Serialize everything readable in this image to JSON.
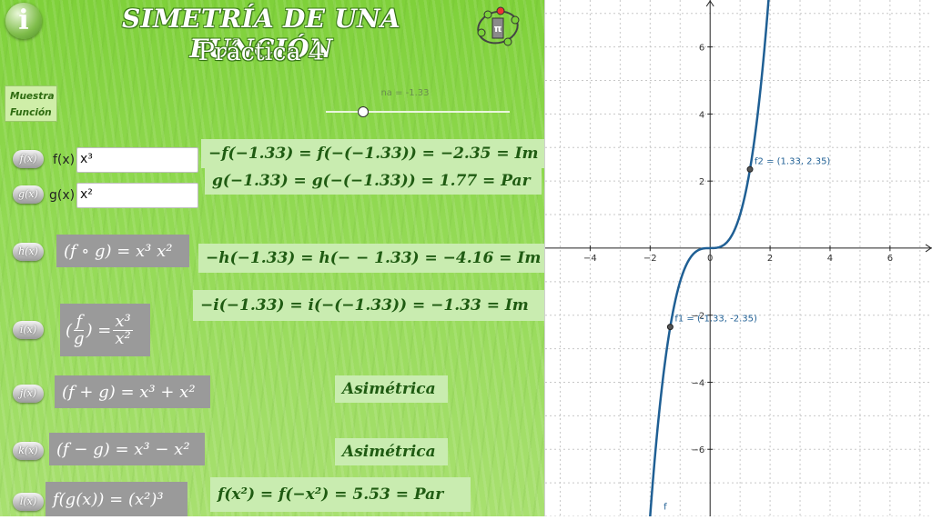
{
  "header": {
    "info_glyph": "i",
    "title": "SIMETRÍA DE UNA FUNCIÓN",
    "subtitle": "Práctica 4",
    "logo_icon": "geogebra-logo-icon"
  },
  "show_function_button": {
    "line1": "Muestra",
    "line2": "Función"
  },
  "slider": {
    "label": "na = -1.33",
    "value": -1.33,
    "min": -3,
    "max": 3
  },
  "functions": {
    "f_button": "f(x)",
    "f_label": "f(x)",
    "f_value": "x³",
    "g_button": "g(x)",
    "g_label": "g(x)",
    "g_value": "x²",
    "h_button": "h(x)",
    "i_button": "i(x)",
    "j_button": "j(x)",
    "k_button": "k(x)",
    "l_button": "l(x)"
  },
  "expressions": {
    "h": "(f ∘ g) = x³ x²",
    "i_left": "(",
    "i_num_f": "f",
    "i_den_g": "g",
    "i_mid": ") =",
    "i_num": "x³",
    "i_den": "x²",
    "j": "(f + g) = x³ + x²",
    "k": "(f − g) = x³ − x²",
    "l": "f(g(x)) = (x²)³"
  },
  "results": {
    "f": "−f(−1.33) = f(−(−1.33)) = −2.35 = Im",
    "g": "g(−1.33) = g(−(−1.33)) = 1.77 = Par",
    "h": "−h(−1.33) = h(− − 1.33) = −4.16 = Im",
    "i": "−i(−1.33) = i(−(−1.33)) = −1.33 = Im",
    "j": "Asimétrica",
    "k": "Asimétrica",
    "l": "f(x²) = f(−x²) = 5.53 = Par"
  },
  "graph": {
    "x_ticks": [
      -4,
      -2,
      0,
      2,
      4,
      6
    ],
    "y_ticks": [
      -6,
      -4,
      -2,
      2,
      4,
      6
    ],
    "x_range": [
      -5.5,
      7.4
    ],
    "y_range": [
      -8,
      7.4
    ],
    "curve_color": "#1f5f94",
    "curve_label": "f",
    "points": [
      {
        "label": "f1 = (-1.33, -2.35)",
        "x": -1.33,
        "y": -2.35
      },
      {
        "label": "f2 = (1.33, 2.35)",
        "x": 1.33,
        "y": 2.35
      }
    ]
  }
}
